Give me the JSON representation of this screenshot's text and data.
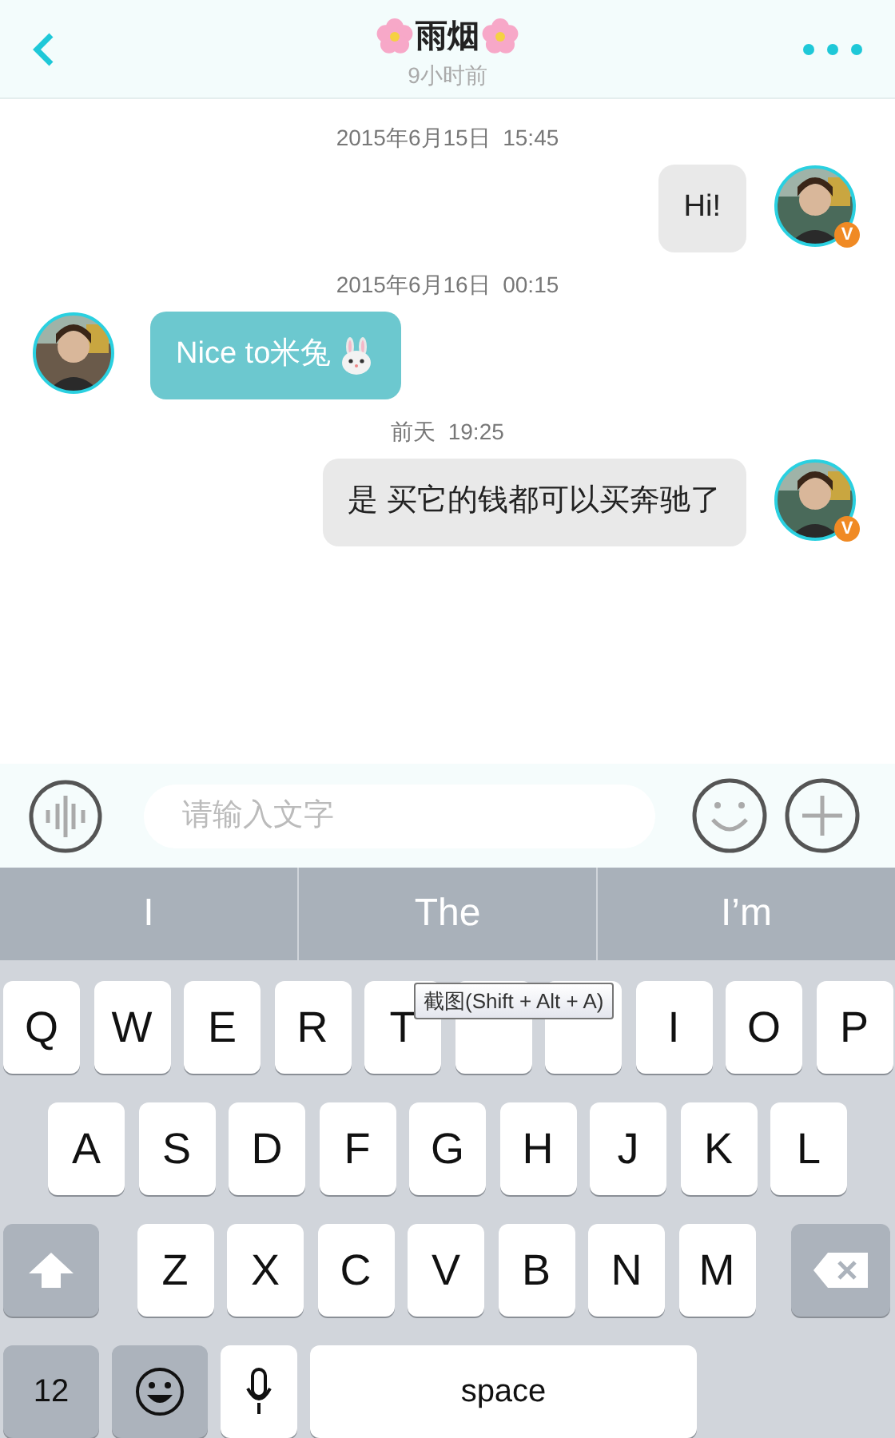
{
  "header": {
    "title": "雨烟",
    "subtitle": "9小时前"
  },
  "messages": [
    {
      "kind": "time",
      "text": "2015年6月15日  15:45"
    },
    {
      "kind": "sent",
      "text": "Hi!",
      "badge": "V",
      "emoji": false
    },
    {
      "kind": "time",
      "text": "2015年6月16日  00:15"
    },
    {
      "kind": "received",
      "text": "Nice to米兔",
      "emoji": true
    },
    {
      "kind": "time",
      "text": "前天  19:25"
    },
    {
      "kind": "sent",
      "text": "是 买它的钱都可以买奔驰了",
      "badge": "V",
      "emoji": false
    }
  ],
  "input": {
    "placeholder": "请输入文字"
  },
  "suggestions": [
    "I",
    "The",
    "I’m"
  ],
  "tooltip": "截图(Shift + Alt + A)",
  "keyboard": [
    [
      {
        "kind": "letter",
        "label": "Q"
      },
      {
        "kind": "letter",
        "label": "W"
      },
      {
        "kind": "letter",
        "label": "E"
      },
      {
        "kind": "letter",
        "label": "R"
      },
      {
        "kind": "letter",
        "label": "T"
      },
      {
        "kind": "covered"
      },
      {
        "kind": "covered"
      },
      {
        "kind": "letter",
        "label": "I"
      },
      {
        "kind": "letter",
        "label": "O"
      },
      {
        "kind": "letter",
        "label": "P"
      }
    ],
    [
      {
        "kind": "letter",
        "label": "A"
      },
      {
        "kind": "letter",
        "label": "S"
      },
      {
        "kind": "letter",
        "label": "D"
      },
      {
        "kind": "letter",
        "label": "F"
      },
      {
        "kind": "letter",
        "label": "G"
      },
      {
        "kind": "letter",
        "label": "H"
      },
      {
        "kind": "letter",
        "label": "J"
      },
      {
        "kind": "letter",
        "label": "K"
      },
      {
        "kind": "letter",
        "label": "L"
      }
    ],
    [
      {
        "kind": "shift"
      },
      {
        "kind": "letter",
        "label": "Z"
      },
      {
        "kind": "letter",
        "label": "X"
      },
      {
        "kind": "letter",
        "label": "C"
      },
      {
        "kind": "letter",
        "label": "V"
      },
      {
        "kind": "letter",
        "label": "B"
      },
      {
        "kind": "letter",
        "label": "N"
      },
      {
        "kind": "letter",
        "label": "M"
      },
      {
        "kind": "delete"
      }
    ],
    [
      {
        "kind": "mode",
        "label": "12"
      },
      {
        "kind": "emoji"
      },
      {
        "kind": "mic"
      },
      {
        "kind": "space",
        "label": "space"
      }
    ]
  ]
}
